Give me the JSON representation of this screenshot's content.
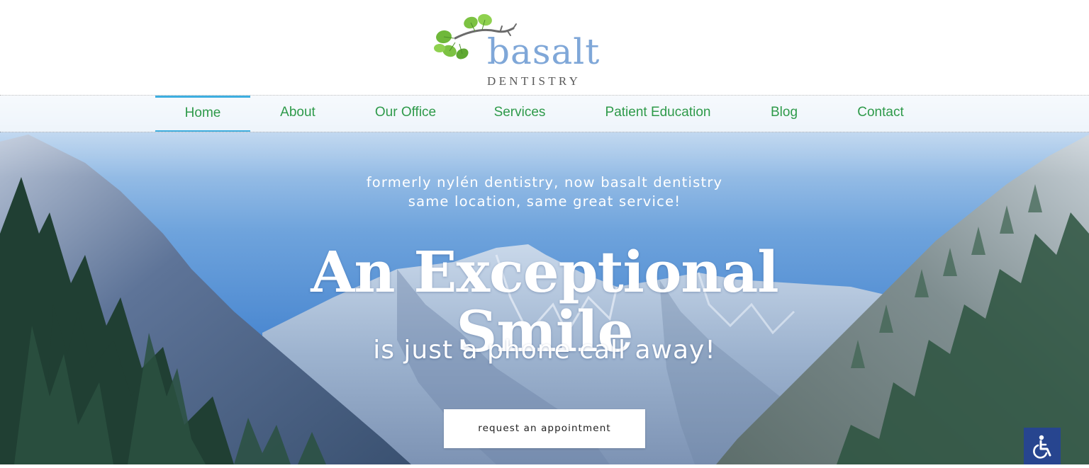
{
  "brand": {
    "name": "basalt",
    "subtitle": "DENTISTRY",
    "color_primary": "#7fa7d8",
    "color_leaf": "#7cc242"
  },
  "nav": {
    "accent": "#3daee0",
    "text_color": "#2e9a4a",
    "items": [
      {
        "label": "Home",
        "active": true
      },
      {
        "label": "About",
        "active": false
      },
      {
        "label": "Our Office",
        "active": false
      },
      {
        "label": "Services",
        "active": false
      },
      {
        "label": "Patient Education",
        "active": false
      },
      {
        "label": "Blog",
        "active": false
      },
      {
        "label": "Contact",
        "active": false
      }
    ]
  },
  "hero": {
    "tagline_line1": "formerly nylén dentistry, now basalt dentistry",
    "tagline_line2": "same location, same great service!",
    "headline": "An Exceptional Smile",
    "subline": "is just a phone call away!",
    "cta_label": "request an appointment"
  },
  "accessibility": {
    "icon": "wheelchair-icon",
    "color": "#27458f"
  }
}
